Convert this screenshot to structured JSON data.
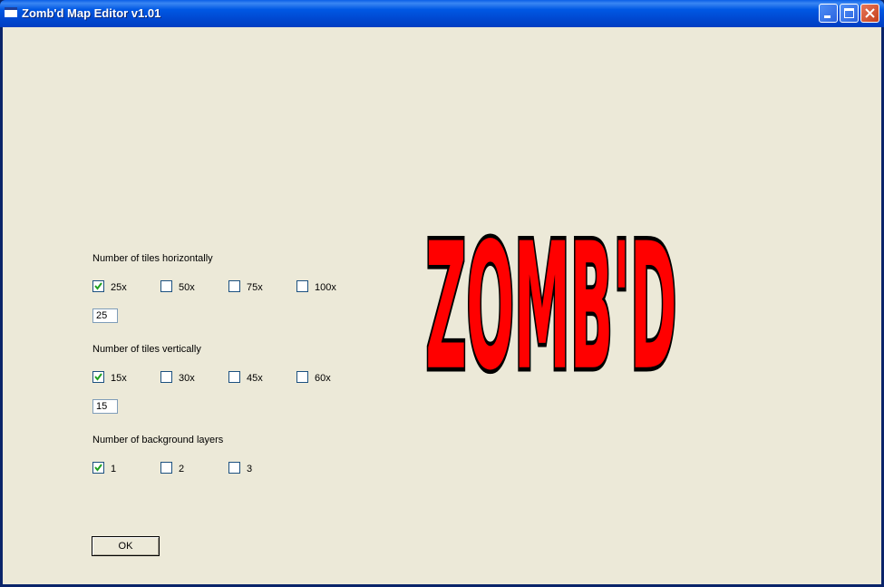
{
  "window": {
    "title": "Zomb'd Map Editor v1.01"
  },
  "horizontal": {
    "label": "Number of tiles horizontally",
    "options": [
      {
        "label": "25x",
        "checked": true
      },
      {
        "label": "50x",
        "checked": false
      },
      {
        "label": "75x",
        "checked": false
      },
      {
        "label": "100x",
        "checked": false
      }
    ],
    "value": "25"
  },
  "vertical": {
    "label": "Number of tiles vertically",
    "options": [
      {
        "label": "15x",
        "checked": true
      },
      {
        "label": "30x",
        "checked": false
      },
      {
        "label": "45x",
        "checked": false
      },
      {
        "label": "60x",
        "checked": false
      }
    ],
    "value": "15"
  },
  "layers": {
    "label": "Number of background layers",
    "options": [
      {
        "label": "1",
        "checked": true
      },
      {
        "label": "2",
        "checked": false
      },
      {
        "label": "3",
        "checked": false
      }
    ]
  },
  "ok_label": "OK",
  "logo": {
    "text": "ZOMB'D",
    "color": "#ff0000"
  }
}
